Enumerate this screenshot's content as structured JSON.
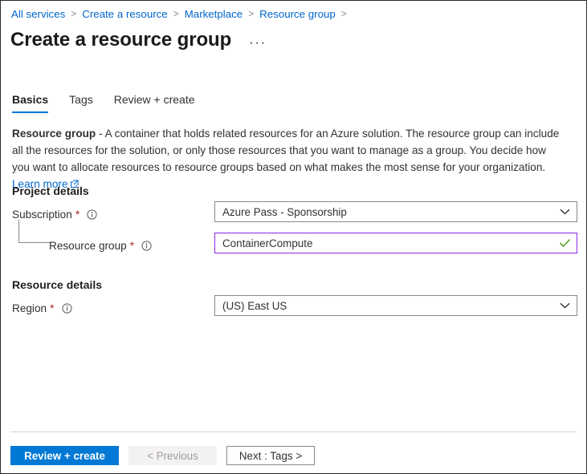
{
  "breadcrumb": {
    "items": [
      {
        "label": "All services"
      },
      {
        "label": "Create a resource"
      },
      {
        "label": "Marketplace"
      },
      {
        "label": "Resource group"
      }
    ],
    "separator": ">",
    "trailing_separator": ">"
  },
  "header": {
    "title": "Create a resource group",
    "more_actions": "···"
  },
  "tabs": [
    {
      "label": "Basics",
      "active": true
    },
    {
      "label": "Tags",
      "active": false
    },
    {
      "label": "Review + create",
      "active": false
    }
  ],
  "description": {
    "lead": "Resource group",
    "body": " - A container that holds related resources for an Azure solution. The resource group can include all the resources for the solution, or only those resources that you want to manage as a group. You decide how you want to allocate resources to resource groups based on what makes the most sense for your organization. ",
    "link_label": "Learn more",
    "link_icon": "external-link-icon"
  },
  "sections": {
    "project_details": {
      "heading": "Project details",
      "fields": {
        "subscription": {
          "label": "Subscription",
          "required_marker": "*",
          "info_icon": "info-icon",
          "value": "Azure Pass - Sponsorship",
          "control": "dropdown",
          "adorn_icon": "chevron-down-icon"
        },
        "resource_group": {
          "label": "Resource group",
          "required_marker": "*",
          "info_icon": "info-icon",
          "value": "ContainerCompute",
          "control": "textbox",
          "adorn_icon": "check-icon",
          "state": "focused-valid"
        }
      }
    },
    "resource_details": {
      "heading": "Resource details",
      "fields": {
        "region": {
          "label": "Region",
          "required_marker": "*",
          "info_icon": "info-icon",
          "value": "(US) East US",
          "control": "dropdown",
          "adorn_icon": "chevron-down-icon"
        }
      }
    }
  },
  "footer": {
    "review_create_label": "Review + create",
    "previous_label": "< Previous",
    "next_label": "Next : Tags >"
  },
  "colors": {
    "accent": "#0078d4",
    "link": "#0066cc",
    "required": "#a4262c",
    "focus_border": "#8a2be2",
    "valid_check": "#5ba32b",
    "border": "#8a8886"
  }
}
